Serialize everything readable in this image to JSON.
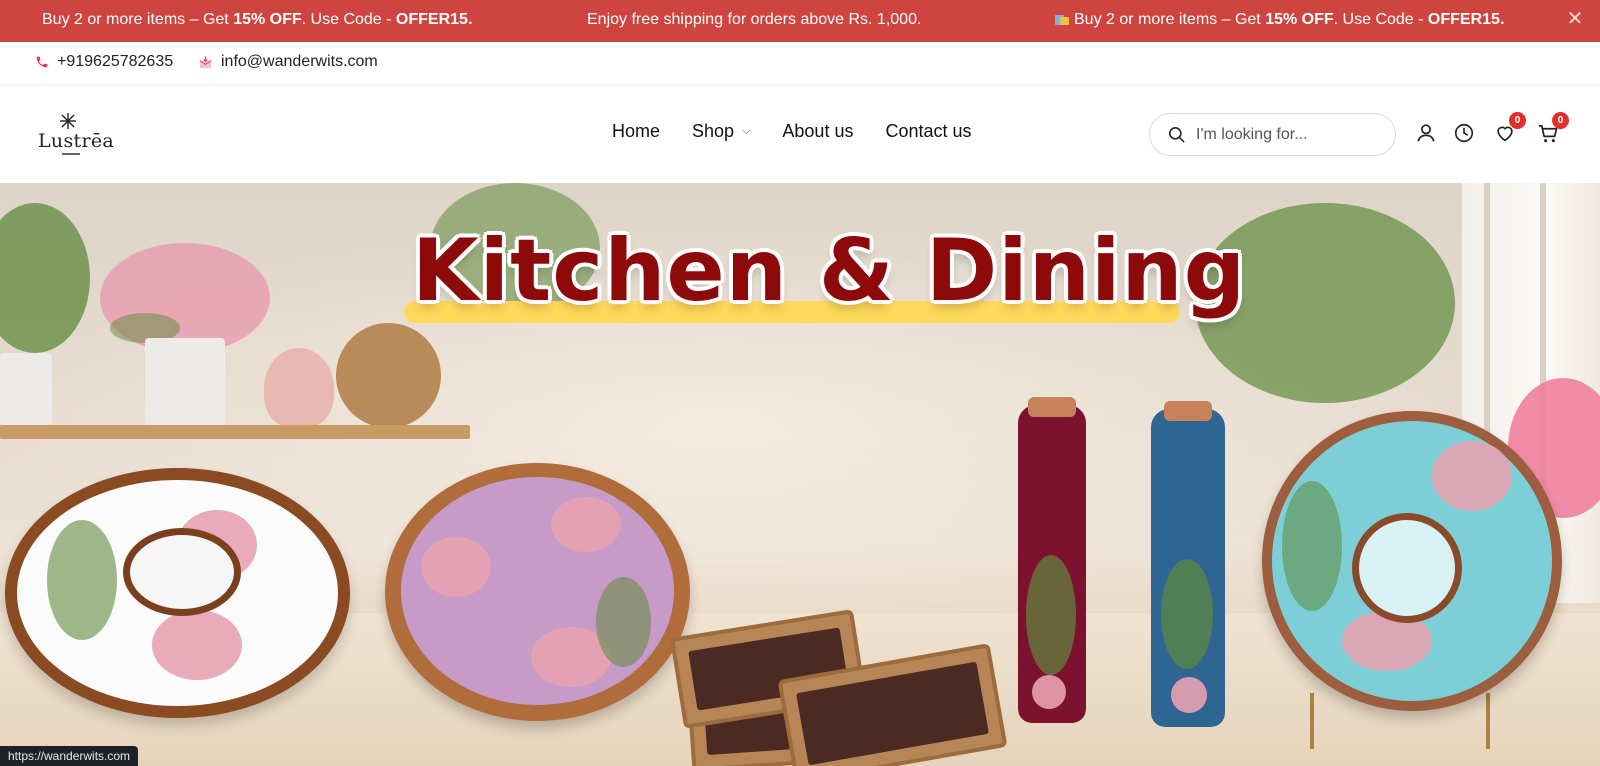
{
  "announcement": {
    "msg1_pre": "Buy 2 or more items – Get ",
    "msg1_bold1": "15% OFF",
    "msg1_mid": ". Use Code - ",
    "msg1_bold2": "OFFER15.",
    "msg2": "Enjoy free shipping for orders above Rs. 1,000.",
    "msg3_pre": "Buy 2 or more items – Get ",
    "msg3_bold1": "15% OFF",
    "msg3_mid": ". Use Code - ",
    "msg3_bold2": "OFFER15.",
    "close_glyph": "✕",
    "background": "#d0443f"
  },
  "contact": {
    "phone": "+919625782635",
    "email": "info@wanderwits.com",
    "icon_color": "#e8336d"
  },
  "logo": {
    "brand": "Lustrēa"
  },
  "nav": {
    "items": [
      {
        "label": "Home"
      },
      {
        "label": "Shop",
        "has_dropdown": true
      },
      {
        "label": "About us"
      },
      {
        "label": "Contact us"
      }
    ]
  },
  "search": {
    "placeholder": "I'm looking for..."
  },
  "header_icons": {
    "wishlist_count": "0",
    "cart_count": "0",
    "badge_color": "#e0302c"
  },
  "hero": {
    "title": "Kitchen & Dining",
    "title_color": "#8e0a0a",
    "underline_color": "#ffd95a"
  },
  "statusbar": {
    "url": "https://wanderwits.com"
  }
}
